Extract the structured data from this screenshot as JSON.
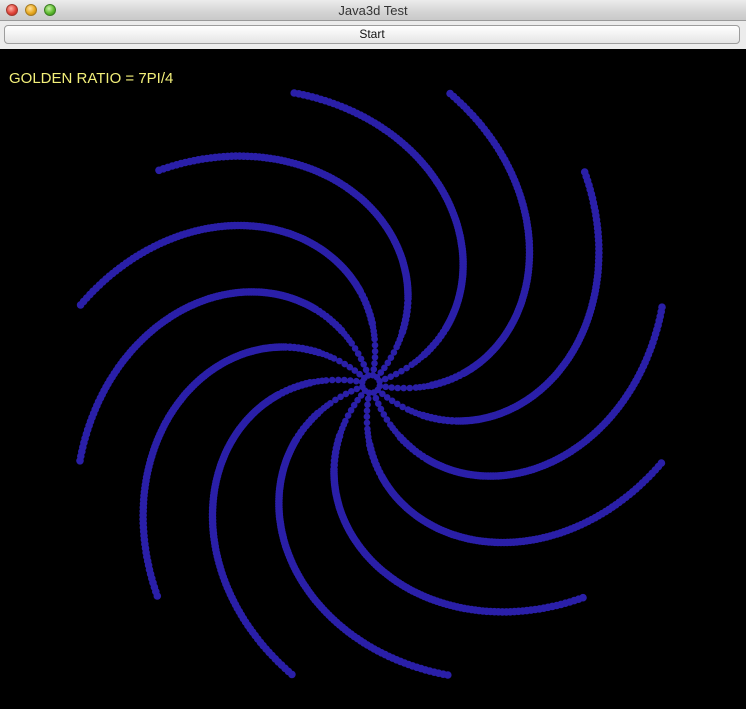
{
  "window": {
    "title": "Java3d Test"
  },
  "toolbar": {
    "start_label": "Start"
  },
  "canvas": {
    "label": "GOLDEN RATIO = 7PI/4",
    "label_color": "#f3f07a",
    "background_color": "#000000",
    "point_color": "#2a1fa8",
    "arm_count": 12
  }
}
